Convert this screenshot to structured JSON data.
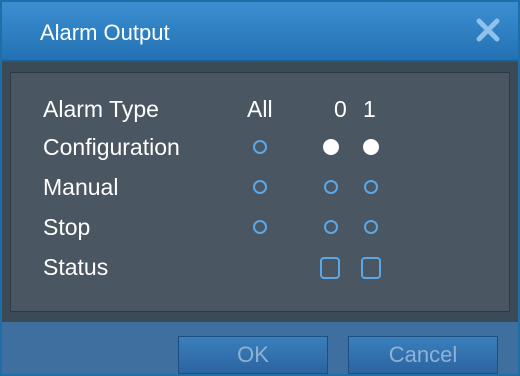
{
  "dialog": {
    "title": "Alarm Output"
  },
  "table": {
    "header_label": "Alarm Type",
    "columns": [
      "All",
      "0",
      "1"
    ],
    "rows": [
      {
        "label": "Configuration",
        "all": false,
        "ch0": true,
        "ch1": true
      },
      {
        "label": "Manual",
        "all": false,
        "ch0": false,
        "ch1": false
      },
      {
        "label": "Stop",
        "all": false,
        "ch0": false,
        "ch1": false
      }
    ],
    "status_label": "Status",
    "status_values": [
      "",
      ""
    ]
  },
  "buttons": {
    "ok": "OK",
    "cancel": "Cancel"
  },
  "colors": {
    "titlebar": "#2b7ec1",
    "accent": "#5aa8e8",
    "panel": "#4a5661"
  },
  "icons": {
    "close": "close-icon"
  }
}
